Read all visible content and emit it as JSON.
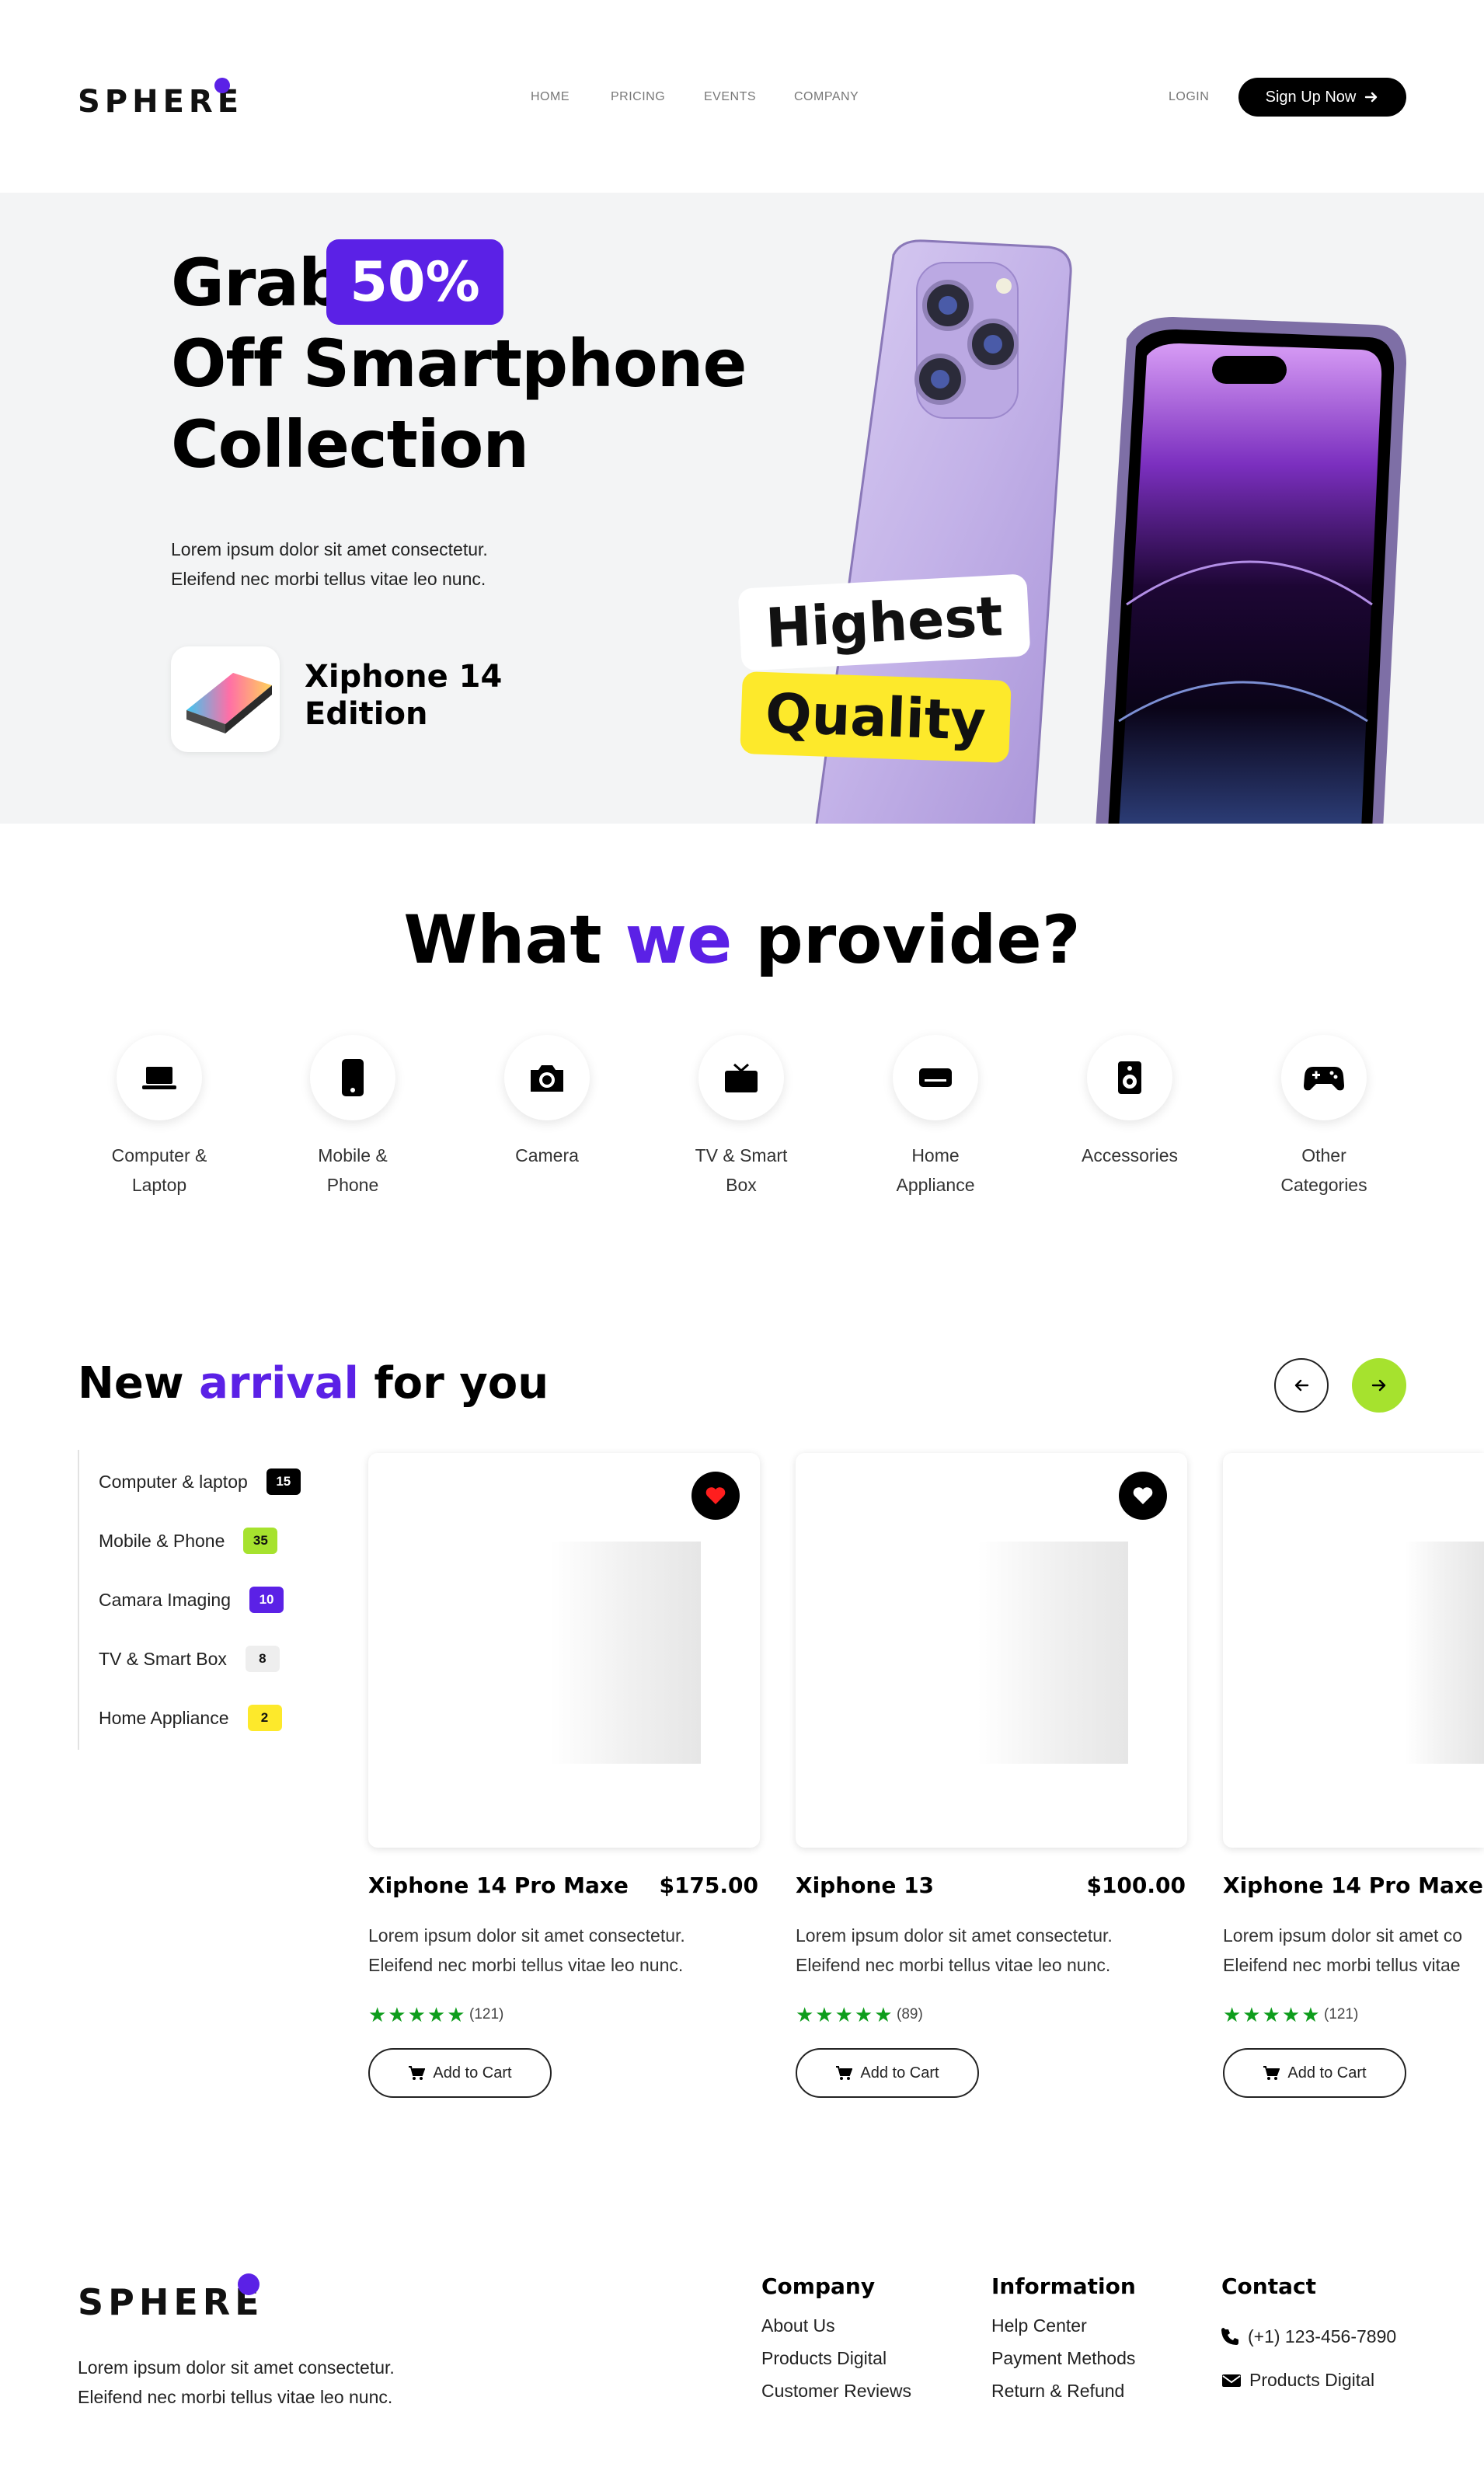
{
  "nav": {
    "logo": "SPHERE",
    "links": [
      "HOME",
      "PRICING",
      "EVENTS",
      "COMPANY"
    ],
    "login": "LOGIN",
    "signup": "Sign Up Now"
  },
  "hero": {
    "title_line1": "Grab",
    "discount": "50%",
    "title_line2": "Off Smartphone",
    "title_line3": "Collection",
    "desc_line1": "Lorem ipsum dolor sit amet consectetur.",
    "desc_line2": "Eleifend nec morbi tellus vitae leo nunc.",
    "edition_line1": "Xiphone 14",
    "edition_line2": "Edition",
    "tag1": "Highest",
    "tag2": "Quality"
  },
  "provide": {
    "title_pre": "What",
    "title_accent": "we",
    "title_post": "provide?",
    "categories": [
      {
        "line1": "Computer &",
        "line2": "Laptop",
        "icon": "laptop-icon"
      },
      {
        "line1": "Mobile &",
        "line2": "Phone",
        "icon": "phone-icon"
      },
      {
        "line1": "Camera",
        "line2": "",
        "icon": "camera-icon"
      },
      {
        "line1": "TV & Smart",
        "line2": "Box",
        "icon": "tv-icon"
      },
      {
        "line1": "Home",
        "line2": "Appliance",
        "icon": "appliance-icon"
      },
      {
        "line1": "Accessories",
        "line2": "",
        "icon": "speaker-icon"
      },
      {
        "line1": "Other",
        "line2": "Categories",
        "icon": "gamepad-icon"
      }
    ]
  },
  "arrivals": {
    "title_pre": "New",
    "title_accent": "arrival",
    "title_post": "for you",
    "sidebar": [
      {
        "label": "Computer & laptop",
        "count": "15",
        "bg": "#000000",
        "fg": "#ffffff"
      },
      {
        "label": "Mobile & Phone",
        "count": "35",
        "bg": "#a6e22e",
        "fg": "#111111"
      },
      {
        "label": "Camara Imaging",
        "count": "10",
        "bg": "#5b21e6",
        "fg": "#ffffff"
      },
      {
        "label": "TV & Smart Box",
        "count": "8",
        "bg": "#eeeeee",
        "fg": "#111111"
      },
      {
        "label": "Home Appliance",
        "count": "2",
        "bg": "#fde92b",
        "fg": "#111111"
      }
    ],
    "products": [
      {
        "name": "Xiphone 14 Pro Maxe",
        "price": "$175.00",
        "desc_line1": "Lorem ipsum dolor sit amet consectetur.",
        "desc_line2": "Eleifend nec morbi tellus vitae leo nunc.",
        "stars": "★★★★★",
        "reviews": "(121)",
        "cart": "Add to Cart",
        "favorited": true
      },
      {
        "name": "Xiphone 13",
        "price": "$100.00",
        "desc_line1": "Lorem ipsum dolor sit amet consectetur.",
        "desc_line2": "Eleifend nec morbi tellus vitae leo nunc.",
        "stars": "★★★★★",
        "reviews": "(89)",
        "cart": "Add to Cart",
        "favorited": false
      },
      {
        "name": "Xiphone 14 Pro Maxe",
        "price": "",
        "desc_line1": "Lorem ipsum dolor sit amet co",
        "desc_line2": "Eleifend nec morbi tellus vitae",
        "stars": "★★★★★",
        "reviews": "(121)",
        "cart": "Add to Cart",
        "favorited": false
      }
    ]
  },
  "footer": {
    "logo": "SPHERE",
    "desc_line1": "Lorem ipsum dolor sit amet consectetur.",
    "desc_line2": "Eleifend nec morbi tellus vitae leo nunc.",
    "company": {
      "title": "Company",
      "links": [
        "About Us",
        "Products Digital",
        "Customer Reviews"
      ]
    },
    "information": {
      "title": "Information",
      "links": [
        "Help Center",
        "Payment Methods",
        "Return & Refund"
      ]
    },
    "contact": {
      "title": "Contact",
      "phone": "(+1) 123-456-7890",
      "email": "Products Digital"
    }
  },
  "colors": {
    "accent": "#5b21e6",
    "lime": "#a6e22e",
    "yellow": "#fde92b",
    "hero_bg": "#f3f4f5"
  }
}
